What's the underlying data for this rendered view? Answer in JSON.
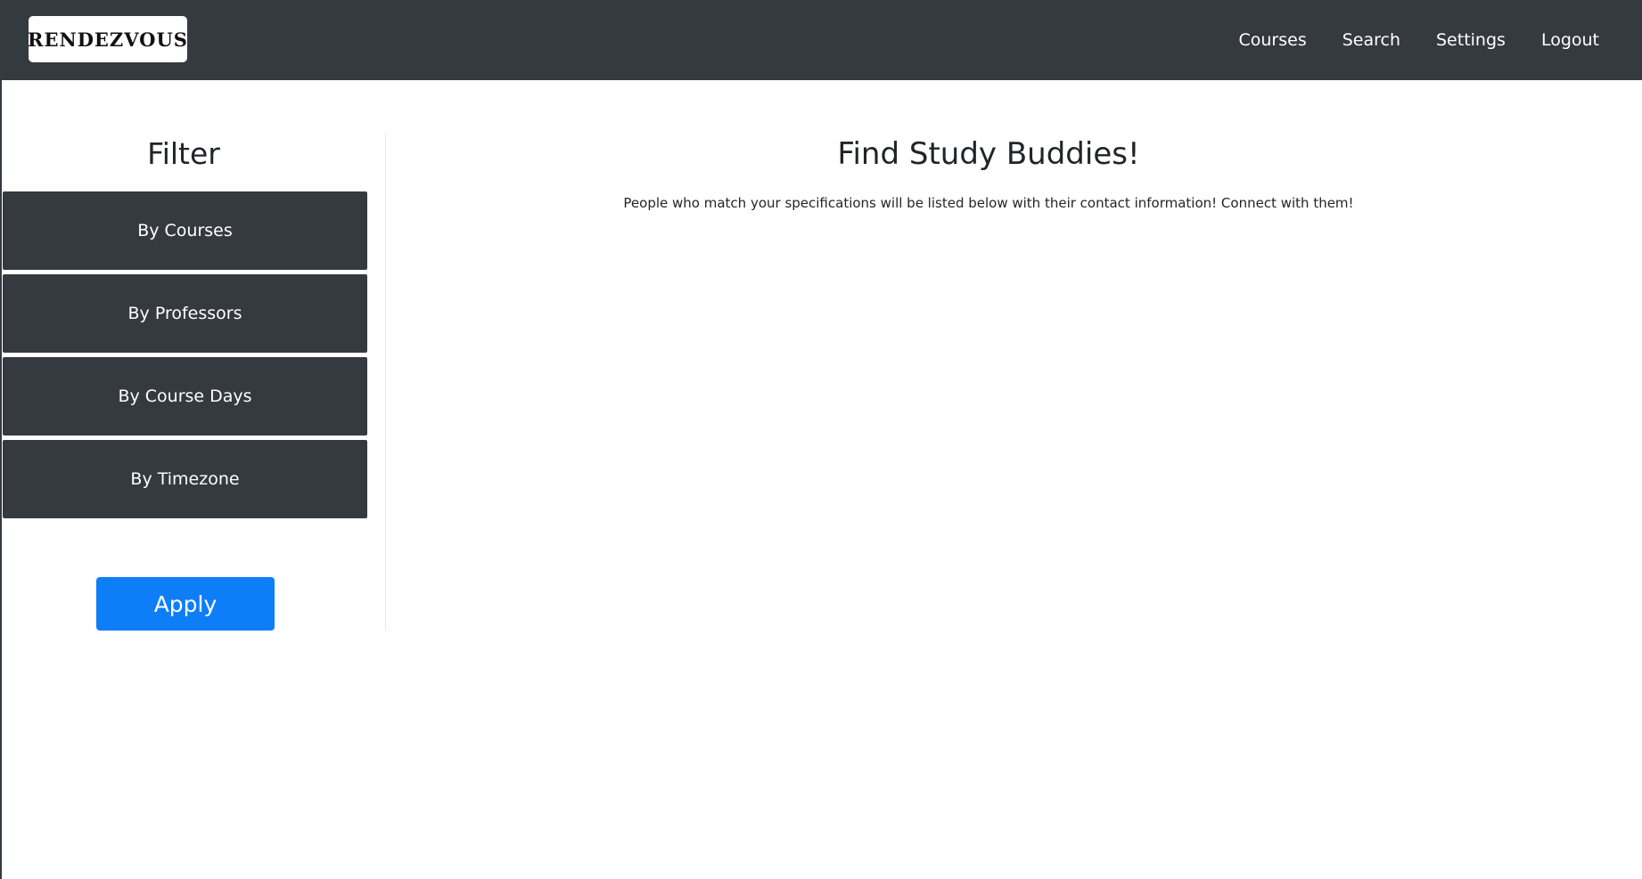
{
  "navbar": {
    "logo_text": "RENDEZVOUS",
    "links": [
      "Courses",
      "Search",
      "Settings",
      "Logout"
    ]
  },
  "sidebar": {
    "title": "Filter",
    "filters": [
      "By Courses",
      "By Professors",
      "By Course Days",
      "By Timezone"
    ],
    "apply_label": "Apply"
  },
  "main": {
    "title": "Find Study Buddies!",
    "description": "People who match your specifications will be listed below with their contact information! Connect with them!"
  },
  "colors": {
    "navbar_bg": "#343a40",
    "accent": "#0d7ef8"
  }
}
